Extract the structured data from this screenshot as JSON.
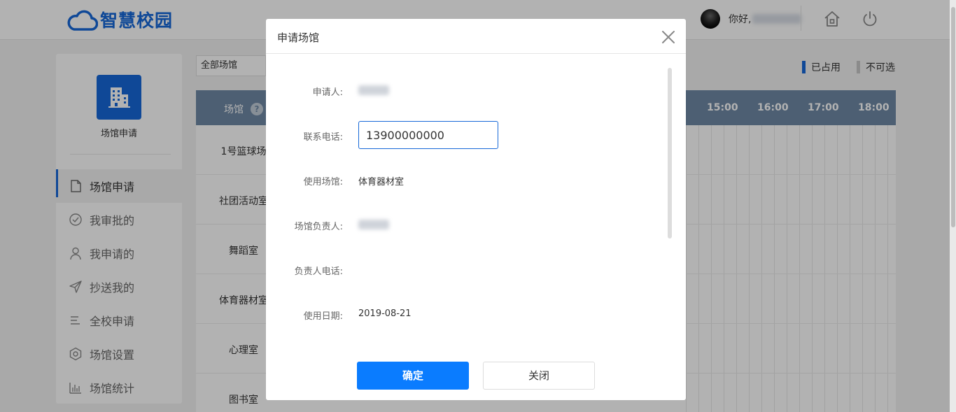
{
  "app": {
    "logo_text": "智慧校园",
    "greeting": "你好,",
    "icons": {
      "logo": "cloud-icon",
      "home": "home-icon",
      "logout": "power-icon"
    }
  },
  "sidebar": {
    "badge_title": "场馆申请",
    "badge_icon": "building-icon",
    "items": [
      {
        "label": "场馆申请",
        "icon": "document-icon",
        "active": true
      },
      {
        "label": "我审批的",
        "icon": "check-circle-icon",
        "active": false
      },
      {
        "label": "我申请的",
        "icon": "user-icon",
        "active": false
      },
      {
        "label": "抄送我的",
        "icon": "send-icon",
        "active": false
      },
      {
        "label": "全校申请",
        "icon": "list-icon",
        "active": false
      },
      {
        "label": "场馆设置",
        "icon": "hexagon-settings-icon",
        "active": false
      },
      {
        "label": "场馆统计",
        "icon": "bar-chart-icon",
        "active": false
      }
    ]
  },
  "main": {
    "filter_value": "全部场馆",
    "legend": {
      "occupied": "已占用",
      "unavailable": "不可选",
      "occupied_color": "#1668d8",
      "unavailable_color": "#c8c8c8"
    },
    "schedule": {
      "venue_header": "场馆",
      "help_symbol": "?",
      "time_headers": [
        "15:00",
        "16:00",
        "17:00",
        "18:00"
      ],
      "venues": [
        "1号篮球场",
        "社团活动室",
        "舞蹈室",
        "体育器材室",
        "心理室",
        "图书室"
      ]
    }
  },
  "modal": {
    "title": "申请场馆",
    "fields": {
      "applicant_label": "申请人:",
      "phone_label": "联系电话:",
      "phone_value": "13900000000",
      "venue_label": "使用场馆:",
      "venue_value": "体育器材室",
      "manager_label": "场馆负责人:",
      "manager_phone_label": "负责人电话:",
      "date_label": "使用日期:",
      "date_value": "2019-08-21"
    },
    "confirm_label": "确定",
    "close_label": "关闭"
  },
  "colors": {
    "primary": "#1668d8",
    "button_blue": "#0a7cff",
    "table_header": "#6f89a5"
  }
}
